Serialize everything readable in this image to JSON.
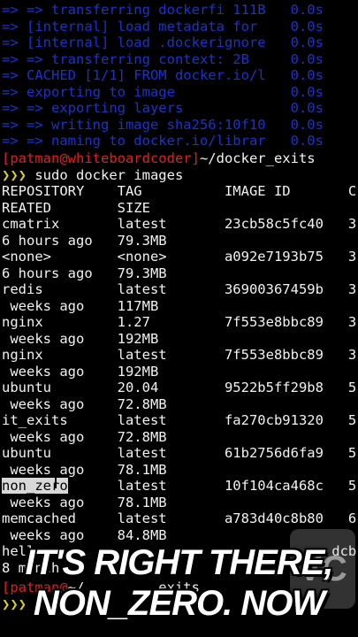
{
  "build_output": [
    "=> => transferring dockerfi 111B   0.0s",
    "=> [internal] load metadata for    0.0s",
    "=> [internal] load .dockerignore   0.0s",
    "=> => transferring context: 2B     0.0s",
    "=> CACHED [1/1] FROM docker.io/l   0.0s",
    "=> exporting to image              0.0s",
    "=> => exporting layers             0.0s",
    "=> => writing image sha256:10f10   0.0s",
    "=> => naming to docker.io/librar   0.0s"
  ],
  "prompt1": {
    "user_host": "[patman@whiteboardcoder]",
    "path": "~/docker_exits"
  },
  "command1": {
    "arrows": "❯❯❯",
    "text": " sudo docker images"
  },
  "table_header": {
    "line1": "REPOSITORY    TAG          IMAGE ID       C",
    "line2": "REATED        SIZE"
  },
  "table_lines": [
    "cmatrix       latest       23cb58c5fc40   3",
    "6 hours ago   79.3MB",
    "<none>        <none>       a092e7193b75   3",
    "6 hours ago   79.3MB",
    "redis         latest       36900367459b   3",
    " weeks ago    117MB",
    "nginx         1.27         7f553e8bbc89   3",
    " weeks ago    192MB",
    "nginx         latest       7f553e8bbc89   3",
    " weeks ago    192MB",
    "ubuntu        20.04        9522b5ff29b8   5",
    " weeks ago    72.8MB",
    "it_exits      latest       fa270cb91320   5",
    " weeks ago    72.8MB",
    "ubuntu        latest       61b2756d6fa9   5",
    " weeks ago    78.1MB"
  ],
  "selected_row": {
    "repo": "non_zero",
    "rest": "      latest       10f104ca468c   5"
  },
  "table_lines_after": [
    " weeks ago    78.1MB",
    "memcached     latest       a783d40c8b80   6",
    " weeks ago    84.8MB",
    "hello-w                                 dcb   1",
    "8 month"
  ],
  "prompt2": {
    "user_host": "[patman@",
    "path": "~/         exits"
  },
  "command2": {
    "arrows": "❯❯❯"
  },
  "caption": {
    "line1": "IT'S RIGHT THERE,",
    "line2": "NON_ZERO. NOW"
  }
}
